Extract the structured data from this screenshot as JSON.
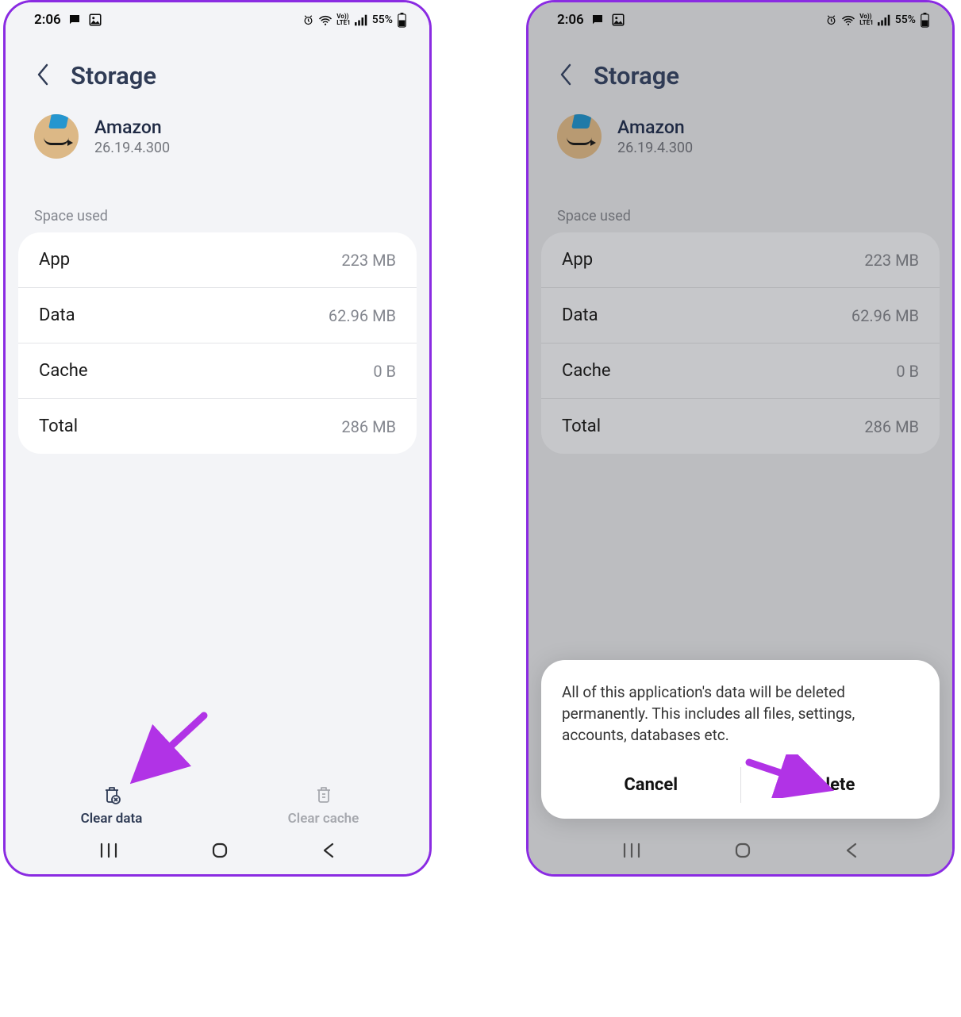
{
  "status": {
    "time": "2:06",
    "battery_pct": "55%"
  },
  "header": {
    "title": "Storage"
  },
  "app": {
    "name": "Amazon",
    "version": "26.19.4.300"
  },
  "section_label": "Space used",
  "rows": {
    "app": {
      "label": "App",
      "value": "223 MB"
    },
    "data": {
      "label": "Data",
      "value": "62.96 MB"
    },
    "cache": {
      "label": "Cache",
      "value": "0 B"
    },
    "total": {
      "label": "Total",
      "value": "286 MB"
    }
  },
  "actions": {
    "clear_data": "Clear data",
    "clear_cache": "Clear cache"
  },
  "dialog": {
    "message": "All of this application's data will be deleted permanently. This includes all files, settings, accounts, databases etc.",
    "cancel": "Cancel",
    "delete": "Delete"
  }
}
